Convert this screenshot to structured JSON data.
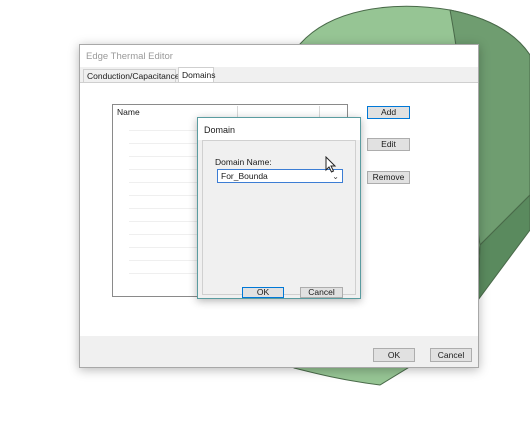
{
  "window": {
    "title": "Edge Thermal Editor",
    "tabs": [
      {
        "label": "Conduction/Capacitance",
        "active": false
      },
      {
        "label": "Domains",
        "active": true
      }
    ]
  },
  "domains_tab": {
    "list": {
      "columns": [
        "Name"
      ],
      "rows": []
    },
    "buttons": {
      "add": "Add",
      "edit": "Edit",
      "remove": "Remove"
    }
  },
  "footer": {
    "ok": "OK",
    "cancel": "Cancel"
  },
  "domain_dialog": {
    "title": "Domain",
    "field_label": "Domain Name:",
    "field_value": "For_Bounda",
    "ok": "OK",
    "cancel": "Cancel"
  },
  "colors": {
    "focus_border": "#0078d7",
    "background_shape_light": "#96c594",
    "background_shape_dark": "#5a8a5e"
  }
}
